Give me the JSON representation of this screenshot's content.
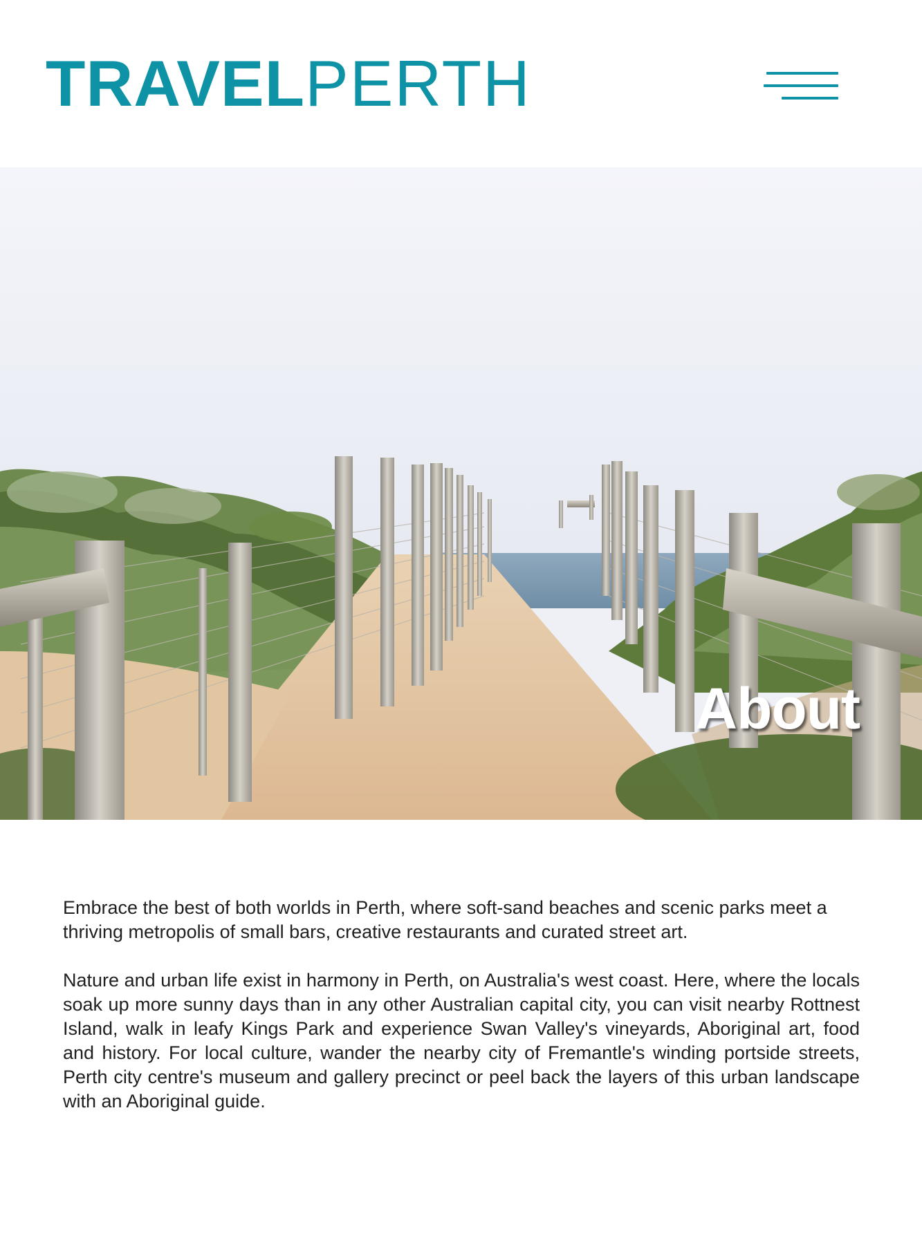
{
  "header": {
    "logo_bold": "TRAVEL",
    "logo_light": "PERTH",
    "menu_icon": "hamburger-menu-icon"
  },
  "hero": {
    "image_description_icon": "coastal-path-photo",
    "title": "About"
  },
  "content": {
    "paragraphs": [
      "Embrace the best of both worlds in Perth, where soft-sand beaches and scenic parks meet a thriving metropolis of small bars, creative restaurants and curated street art.",
      "Nature and urban life exist in harmony in Perth, on Australia's west coast. Here, where the locals soak up more sunny days than in any other Australian capital city, you can visit nearby Rottnest Island, walk in leafy Kings Park and experience Swan Valley's vineyards, Aboriginal art, food and history. For local culture, wander the nearby city of Fremantle's winding portside streets, Perth city centre's museum and gallery precinct or peel back the layers of this urban landscape with an Aboriginal guide."
    ]
  },
  "colors": {
    "brand": "#0e93a6",
    "text": "#1f1f1f",
    "background": "#ffffff"
  }
}
